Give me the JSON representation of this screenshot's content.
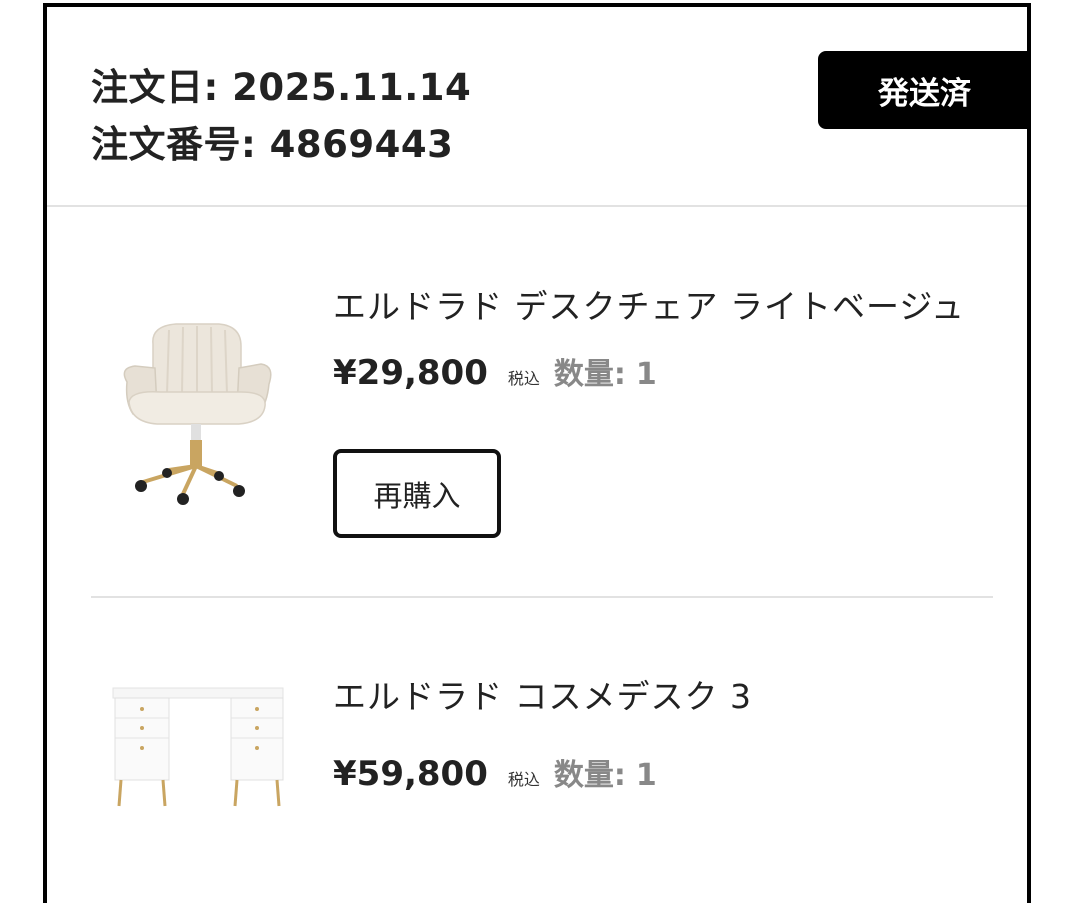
{
  "order": {
    "date_label": "注文日: 2025.11.14",
    "number_label": "注文番号: 4869443",
    "status": "発送済"
  },
  "items": [
    {
      "name": "エルドラド デスクチェア ライトベージュ",
      "price": "¥29,800",
      "tax_label": "税込",
      "qty_label": "数量:",
      "qty_value": "1",
      "rebuy_label": "再購入",
      "image_icon": "desk-chair-image"
    },
    {
      "name": "エルドラド コスメデスク 3",
      "price": "¥59,800",
      "tax_label": "税込",
      "qty_label": "数量:",
      "qty_value": "1",
      "image_icon": "cosmetic-desk-image"
    }
  ],
  "colors": {
    "status_badge_bg": "#000000",
    "status_badge_text": "#ffffff",
    "quantity_text": "#888888",
    "divider": "#e2e2e2",
    "chair_upholstery": "#ece6dc",
    "gold_accent": "#c9a561"
  }
}
